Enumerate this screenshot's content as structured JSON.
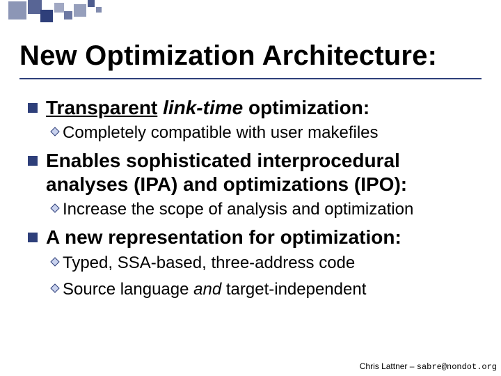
{
  "title": "New Optimization Architecture:",
  "items": [
    {
      "label_html": "<span class='u'>Transparent</span> <span class='i'>link-time</span> optimization:",
      "subs": [
        {
          "text_html": "Completely compatible with user makefiles"
        }
      ]
    },
    {
      "label_html": "Enables sophisticated interprocedural analyses (IPA) and optimizations (IPO):",
      "subs": [
        {
          "text_html": "Increase the scope of analysis and optimization"
        }
      ]
    },
    {
      "label_html": "A new representation for optimization:",
      "subs": [
        {
          "text_html": "Typed, SSA-based, three-address code"
        },
        {
          "text_html": "Source language <span class='i'>and</span> target-independent"
        }
      ]
    }
  ],
  "footer": {
    "author": "Chris Lattner – ",
    "email": "sabre@nondot.org"
  },
  "colors": {
    "accent": "#2e3f7a",
    "diamond_light": "#c9d2ee"
  }
}
